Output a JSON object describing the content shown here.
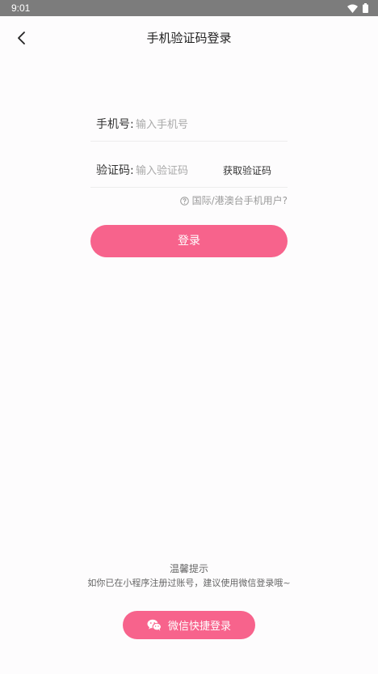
{
  "status_bar": {
    "time": "9:01",
    "icons": [
      "wifi-icon",
      "battery-icon"
    ]
  },
  "header": {
    "title": "手机验证码登录",
    "back_icon": "chevron-left-icon"
  },
  "form": {
    "phone": {
      "label": "手机号:",
      "placeholder": "输入手机号",
      "value": ""
    },
    "code": {
      "label": "验证码:",
      "placeholder": "输入验证码",
      "value": "",
      "get_code_label": "获取验证码"
    },
    "intl_link": {
      "icon": "help-circle-icon",
      "label": "国际/港澳台手机用户?"
    },
    "login_label": "登录"
  },
  "footer": {
    "tip_title": "温馨提示",
    "tip_text": "如你已在小程序注册过账号，建议使用微信登录哦~",
    "wechat_icon": "wechat-icon",
    "wechat_login_label": "微信快捷登录"
  },
  "colors": {
    "accent": "#f7638c",
    "status_bar": "#7c7c7c",
    "background": "#fdfcfd",
    "placeholder": "#a9a9a9"
  }
}
